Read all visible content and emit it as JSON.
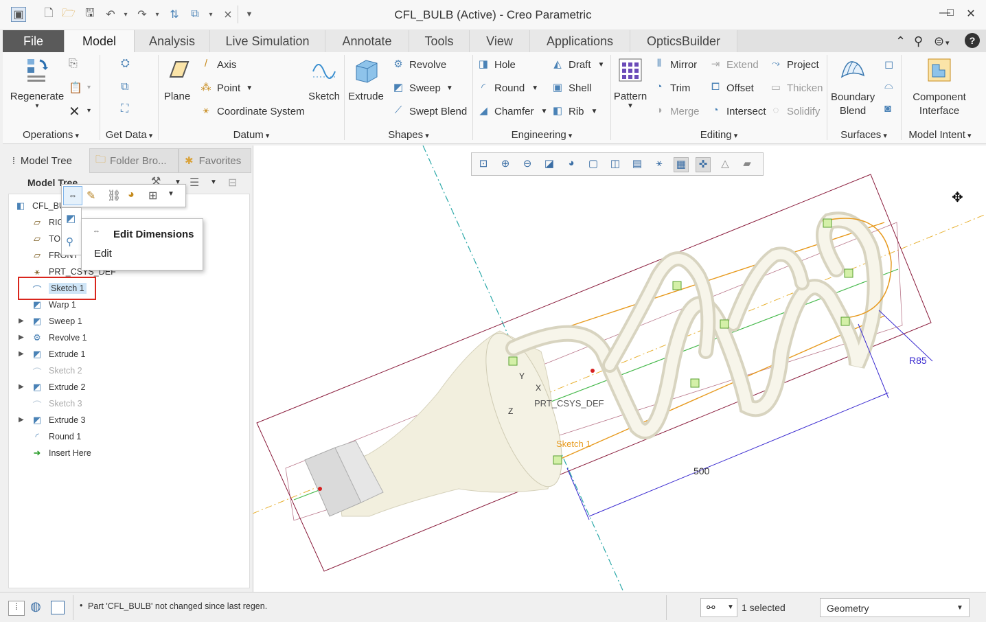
{
  "window": {
    "title": "CFL_BULB (Active) - Creo Parametric",
    "controls": [
      "minimize",
      "maximize",
      "close"
    ]
  },
  "ribbon": {
    "tabs": [
      "File",
      "Model",
      "Analysis",
      "Live Simulation",
      "Annotate",
      "Tools",
      "View",
      "Applications",
      "OpticsBuilder"
    ],
    "active_tab": "Model",
    "groups": {
      "operations": {
        "label": "Operations",
        "regenerate": "Regenerate"
      },
      "get_data": {
        "label": "Get Data"
      },
      "datum": {
        "label": "Datum",
        "plane": "Plane",
        "axis": "Axis",
        "point": "Point",
        "csys": "Coordinate System",
        "sketch": "Sketch"
      },
      "shapes": {
        "label": "Shapes",
        "extrude": "Extrude",
        "revolve": "Revolve",
        "sweep": "Sweep",
        "swept_blend": "Swept Blend"
      },
      "engineering": {
        "label": "Engineering",
        "hole": "Hole",
        "round": "Round",
        "chamfer": "Chamfer",
        "draft": "Draft",
        "shell": "Shell",
        "rib": "Rib"
      },
      "editing": {
        "label": "Editing",
        "pattern": "Pattern",
        "mirror": "Mirror",
        "trim": "Trim",
        "merge": "Merge",
        "extend": "Extend",
        "offset": "Offset",
        "intersect": "Intersect",
        "project": "Project",
        "thicken": "Thicken",
        "solidify": "Solidify"
      },
      "surfaces": {
        "label": "Surfaces",
        "boundary_blend": "Boundary Blend"
      },
      "model_intent": {
        "label": "Model Intent",
        "component_interface": "Component Interface"
      }
    }
  },
  "left_pane": {
    "tabs": [
      "Model Tree",
      "Folder Bro...",
      "Favorites"
    ],
    "header": "Model Tree",
    "tree": [
      {
        "label": "CFL_BULB",
        "shown": "CFL_BUL",
        "icon": "part-icon",
        "expander": false,
        "dim": false
      },
      {
        "label": "RIGHT",
        "shown": "RIG",
        "icon": "datum-plane-icon",
        "expander": false,
        "dim": false
      },
      {
        "label": "TOP",
        "shown": "TO",
        "icon": "datum-plane-icon",
        "expander": false,
        "dim": false
      },
      {
        "label": "FRONT",
        "shown": "FRONT",
        "icon": "datum-plane-icon",
        "expander": false,
        "dim": false
      },
      {
        "label": "PRT_CSYS_DEF",
        "shown": "PRT_CSYS_DEF",
        "icon": "csys-icon",
        "expander": false,
        "dim": false
      },
      {
        "label": "Sketch 1",
        "shown": "Sketch 1",
        "icon": "sketch-icon",
        "expander": false,
        "dim": false,
        "selected": true
      },
      {
        "label": "Warp 1",
        "shown": "Warp 1",
        "icon": "warp-icon",
        "expander": false,
        "dim": false
      },
      {
        "label": "Sweep 1",
        "shown": "Sweep 1",
        "icon": "sweep-icon",
        "expander": true,
        "dim": false
      },
      {
        "label": "Revolve 1",
        "shown": "Revolve 1",
        "icon": "revolve-icon",
        "expander": true,
        "dim": false
      },
      {
        "label": "Extrude 1",
        "shown": "Extrude 1",
        "icon": "extrude-icon",
        "expander": true,
        "dim": false
      },
      {
        "label": "Sketch 2",
        "shown": "Sketch 2",
        "icon": "sketch-icon",
        "expander": false,
        "dim": true
      },
      {
        "label": "Extrude 2",
        "shown": "Extrude 2",
        "icon": "extrude-icon",
        "expander": true,
        "dim": false
      },
      {
        "label": "Sketch 3",
        "shown": "Sketch 3",
        "icon": "sketch-icon",
        "expander": false,
        "dim": true
      },
      {
        "label": "Extrude 3",
        "shown": "Extrude 3",
        "icon": "extrude-icon",
        "expander": true,
        "dim": false
      },
      {
        "label": "Round 1",
        "shown": "Round 1",
        "icon": "round-icon",
        "expander": false,
        "dim": false
      },
      {
        "label": "Insert Here",
        "shown": "Insert Here",
        "icon": "insert-arrow-icon",
        "expander": false,
        "dim": false
      }
    ]
  },
  "context_menu": {
    "items": [
      "Edit Dimensions",
      "Edit"
    ]
  },
  "graphics": {
    "labels": {
      "csys": "PRT_CSYS_DEF",
      "sketch": "Sketch 1",
      "dim_length": "500",
      "dim_radius": "R85",
      "axis_y": "Y",
      "axis_x": "X",
      "axis_z": "Z"
    }
  },
  "status": {
    "message": "Part 'CFL_BULB' not changed since last regen.",
    "selected": "1 selected",
    "filter": "Geometry"
  },
  "colors": {
    "file_tab": "#5a5a5a",
    "selection_outline": "#d9251c",
    "tree_selected_bg": "#cfe5f7",
    "bulb": "#f4f2e4",
    "datum_orange": "#e79a1e",
    "dimension_blue": "#3a2ad0",
    "axis_teal": "#2aa8a8"
  }
}
